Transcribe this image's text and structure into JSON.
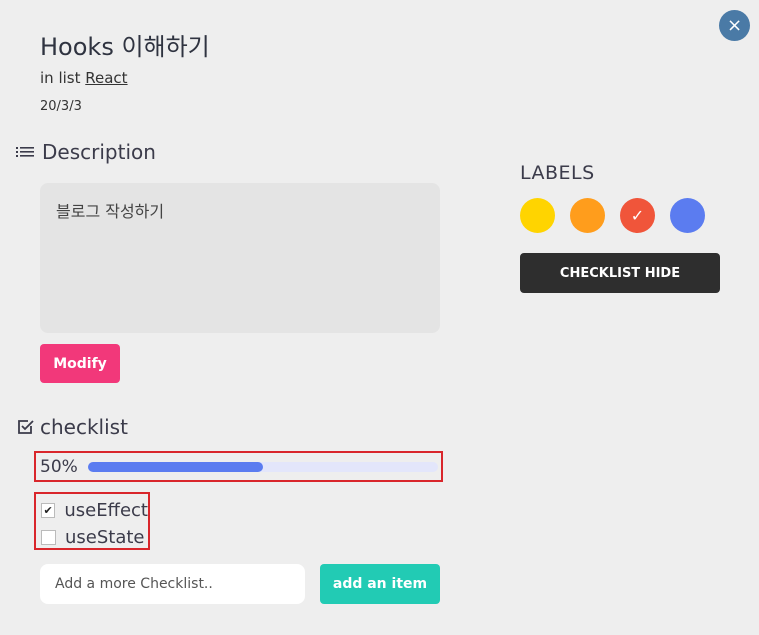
{
  "card": {
    "title": "Hooks 이해하기",
    "list_prefix": "in list",
    "list_name": "React",
    "date": "20/3/3",
    "close_icon": "×"
  },
  "description": {
    "heading": "Description",
    "text": "블로그 작성하기",
    "modify_label": "Modify"
  },
  "checklist": {
    "heading": "checklist",
    "progress_text": "50%",
    "progress_fraction": 0.5,
    "items": [
      {
        "label": "useEffect",
        "checked": true,
        "mark": "✔"
      },
      {
        "label": "useState",
        "checked": false,
        "mark": ""
      }
    ],
    "input_placeholder": "Add a more Checklist..",
    "add_label": "add an item"
  },
  "labels": {
    "heading": "LABELS",
    "colors": [
      "#ffd400",
      "#ff9d1c",
      "#f0553a",
      "#5b7cf0"
    ],
    "selected_mark": "✓",
    "hide_label": "CHECKLIST HIDE"
  }
}
